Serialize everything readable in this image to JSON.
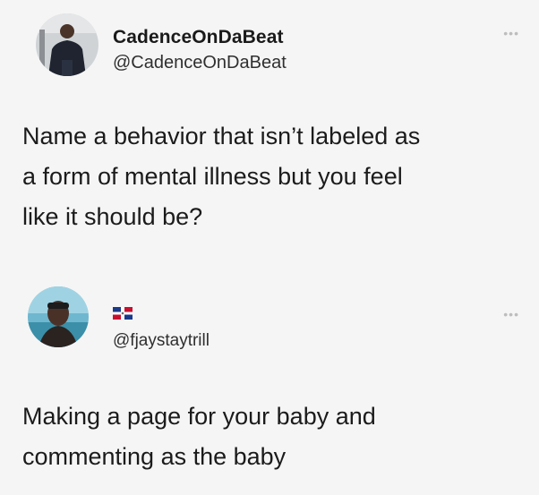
{
  "post_1": {
    "display_name": "CadenceOnDaBeat",
    "handle": "@CadenceOnDaBeat",
    "text": "Name a behavior that isn’t labeled as\na form of mental illness but you feel\nlike it should be?",
    "more_icon": "•••",
    "avatar_icon": "user-photo-avatar"
  },
  "post_2": {
    "flag_icon": "dominican-republic-flag",
    "handle": "@fjaystaytrill",
    "text": "Making a page for your baby and\ncommenting as the baby",
    "more_icon": "•••",
    "avatar_icon": "user-photo-avatar"
  }
}
